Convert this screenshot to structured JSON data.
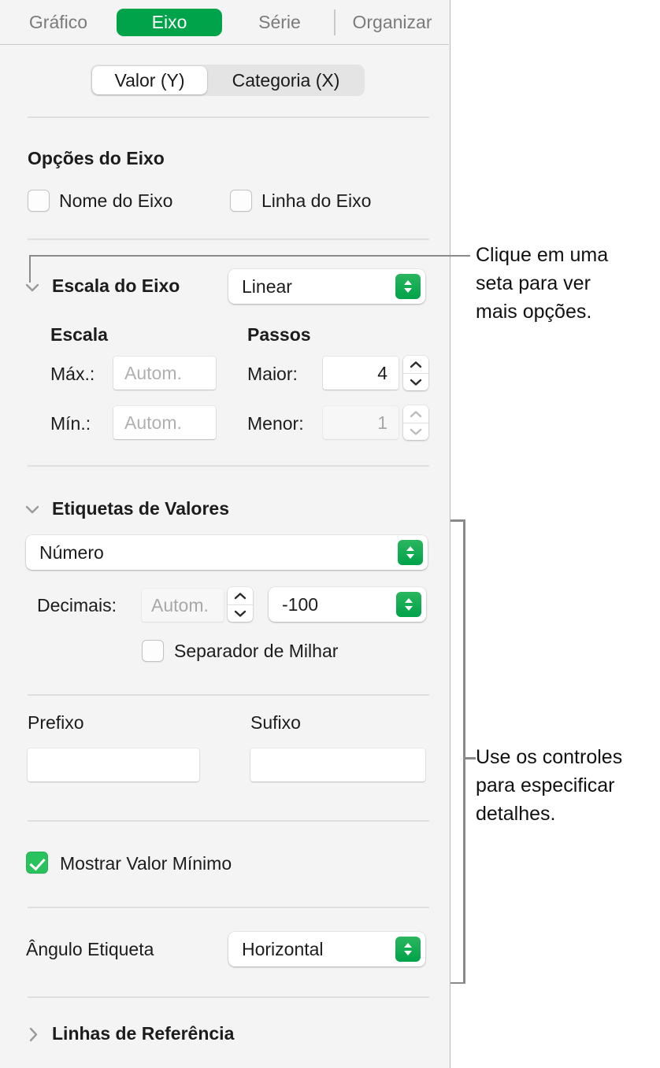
{
  "tabs": [
    {
      "label": "Gráfico",
      "selected": false
    },
    {
      "label": "Eixo",
      "selected": true
    },
    {
      "label": "Série",
      "selected": false
    },
    {
      "label": "Organizar",
      "selected": false
    }
  ],
  "segmented": {
    "options": [
      {
        "label": "Valor (Y)",
        "selected": true
      },
      {
        "label": "Categoria (X)",
        "selected": false
      }
    ]
  },
  "axis_options": {
    "heading": "Opções do Eixo",
    "checkbox_axis_name": {
      "label": "Nome do Eixo",
      "checked": false
    },
    "checkbox_axis_line": {
      "label": "Linha do Eixo",
      "checked": false
    }
  },
  "axis_scale": {
    "heading": "Escala do Eixo",
    "expanded": true,
    "scale_type": "Linear",
    "col_scale_header": "Escala",
    "col_steps_header": "Passos",
    "max_label": "Máx.:",
    "max_value": "",
    "max_placeholder": "Autom.",
    "min_label": "Mín.:",
    "min_value": "",
    "min_placeholder": "Autom.",
    "major_label": "Maior:",
    "major_value": "4",
    "minor_label": "Menor:",
    "minor_value": "1",
    "minor_disabled": true
  },
  "value_labels": {
    "heading": "Etiquetas de Valores",
    "expanded": true,
    "format": "Número",
    "decimals_label": "Decimais:",
    "decimals_value": "",
    "decimals_placeholder": "Autom.",
    "negative_style": "-100",
    "thousands_separator": {
      "label": "Separador de Milhar",
      "checked": false
    },
    "prefix_label": "Prefixo",
    "prefix_value": "",
    "suffix_label": "Sufixo",
    "suffix_value": "",
    "show_min_value": {
      "label": "Mostrar Valor Mínimo",
      "checked": true
    },
    "label_angle_label": "Ângulo Etiqueta",
    "label_angle_value": "Horizontal"
  },
  "reference_lines": {
    "heading": "Linhas de Referência",
    "expanded": false
  },
  "callouts": [
    {
      "text": "Clique em uma\nseta para ver\nmais opções."
    },
    {
      "text": "Use os controles\npara especificar\ndetalhes."
    }
  ],
  "colors": {
    "accent_green": "#00a24a",
    "checkbox_green": "#29c25e",
    "panel_bg": "#f4f4f4",
    "leader_gray": "#8a8a8a"
  }
}
